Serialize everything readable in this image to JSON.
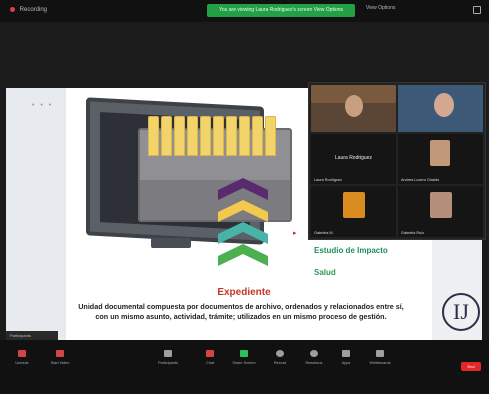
{
  "topbar": {
    "recording_label": "Recording",
    "share_banner": "You are viewing Laura Rodriguez's screen  View Options",
    "view_options": "View Options"
  },
  "slide": {
    "page_indicator": "• • •",
    "label_impacto": "Estudio de Impacto",
    "label_salud": "Salud",
    "title": "Expediente",
    "body": "Unidad documental compuesta por documentos de archivo, ordenados y relacionados entre sí, con un mismo asunto, actividad, trámite; utilizados en un mismo proceso de gestión.",
    "logo_text": "IJ"
  },
  "gallery": {
    "center_name": "Laura Rodriguez",
    "tiles": [
      {
        "name": ""
      },
      {
        "name": ""
      },
      {
        "name": "Laura Rodriguez"
      },
      {
        "name": "Andrea Lucero Giraldo"
      },
      {
        "name": "Gabriela M."
      },
      {
        "name": "Gabriela Ruiz"
      }
    ]
  },
  "participant_strip": {
    "name": "Participants"
  },
  "toolbar": {
    "items": [
      {
        "label": "Unmute",
        "color": "#d64545"
      },
      {
        "label": "Start Video",
        "color": "#d64545"
      },
      {
        "label": "Participants",
        "color": "#9aa0a6"
      },
      {
        "label": "Chat",
        "color": "#d64545"
      },
      {
        "label": "Share Screen",
        "color": "#2fbf5b"
      },
      {
        "label": "Record",
        "color": "#9aa0a6"
      },
      {
        "label": "Reactions",
        "color": "#9aa0a6"
      },
      {
        "label": "Apps",
        "color": "#9aa0a6"
      },
      {
        "label": "Whiteboards",
        "color": "#9aa0a6"
      }
    ],
    "end_label": "End"
  },
  "colors": {
    "chevron_purple": "#5a2a6e",
    "chevron_yellow": "#f2c94c",
    "chevron_teal": "#48b3a8",
    "chevron_green": "#4caf50"
  }
}
